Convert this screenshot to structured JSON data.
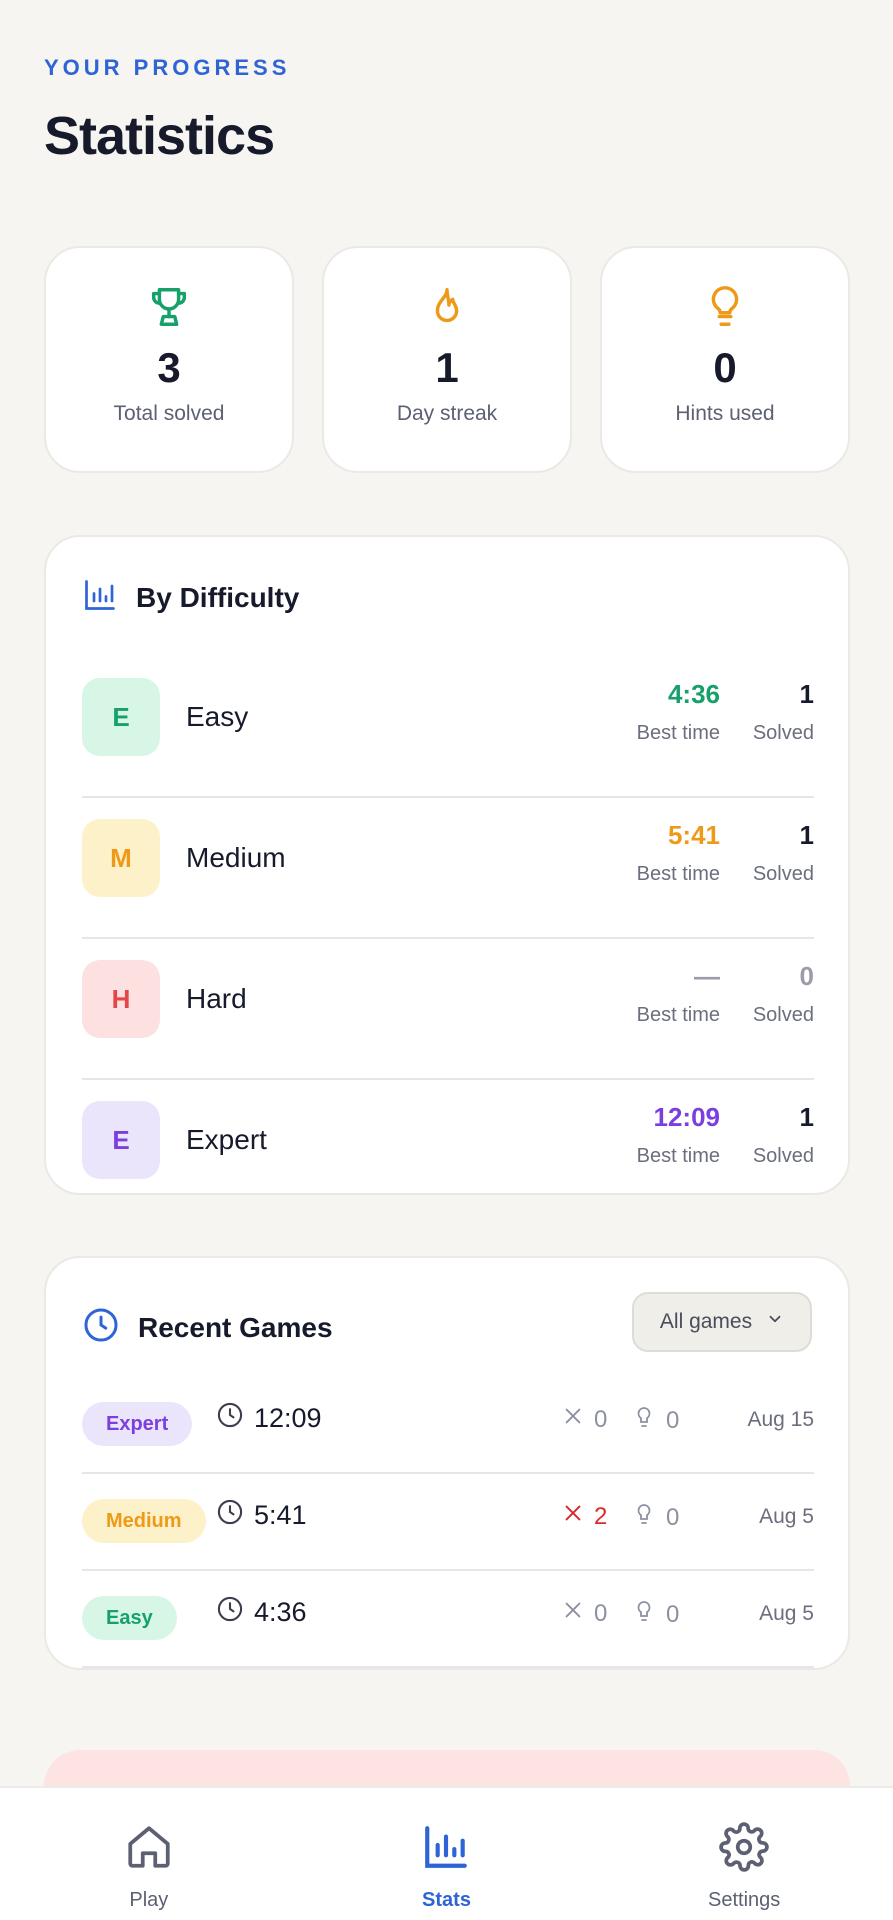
{
  "header": {
    "eyebrow": "YOUR PROGRESS",
    "title": "Statistics"
  },
  "summary": [
    {
      "icon": "trophy-icon",
      "value": "3",
      "label": "Total solved",
      "color": "#16a06a"
    },
    {
      "icon": "flame-icon",
      "value": "1",
      "label": "Day streak",
      "color": "#ee9a18"
    },
    {
      "icon": "lightbulb-icon",
      "value": "0",
      "label": "Hints used",
      "color": "#ee9a18"
    }
  ],
  "difficulty": {
    "title": "By Difficulty",
    "best_label": "Best time",
    "solved_label": "Solved",
    "rows": [
      {
        "badge": "E",
        "name": "Easy",
        "best": "4:36",
        "solved": "1",
        "color": "#16a06a",
        "bg": "#d7f6e6"
      },
      {
        "badge": "M",
        "name": "Medium",
        "best": "5:41",
        "solved": "1",
        "color": "#ee9a18",
        "bg": "#fdf1c9"
      },
      {
        "badge": "H",
        "name": "Hard",
        "best": "—",
        "solved": "0",
        "color": "#e34747",
        "bg": "#fde1e1"
      },
      {
        "badge": "E",
        "name": "Expert",
        "best": "12:09",
        "solved": "1",
        "color": "#7b3fe0",
        "bg": "#ebe5fc"
      }
    ]
  },
  "recent": {
    "title": "Recent Games",
    "filter": "All games",
    "games": [
      {
        "level": "Expert",
        "time": "12:09",
        "errors": "0",
        "hints": "0",
        "date": "Aug 15",
        "color": "#7b3fe0",
        "bg": "#ebe5fc"
      },
      {
        "level": "Medium",
        "time": "5:41",
        "errors": "2",
        "hints": "0",
        "date": "Aug 5",
        "color": "#ee9a18",
        "bg": "#fdf1c9"
      },
      {
        "level": "Easy",
        "time": "4:36",
        "errors": "0",
        "hints": "0",
        "date": "Aug 5",
        "color": "#16a06a",
        "bg": "#d7f6e6"
      }
    ]
  },
  "nav": [
    {
      "label": "Play",
      "icon": "home-icon"
    },
    {
      "label": "Stats",
      "icon": "bar-chart-icon"
    },
    {
      "label": "Settings",
      "icon": "gear-icon"
    }
  ]
}
